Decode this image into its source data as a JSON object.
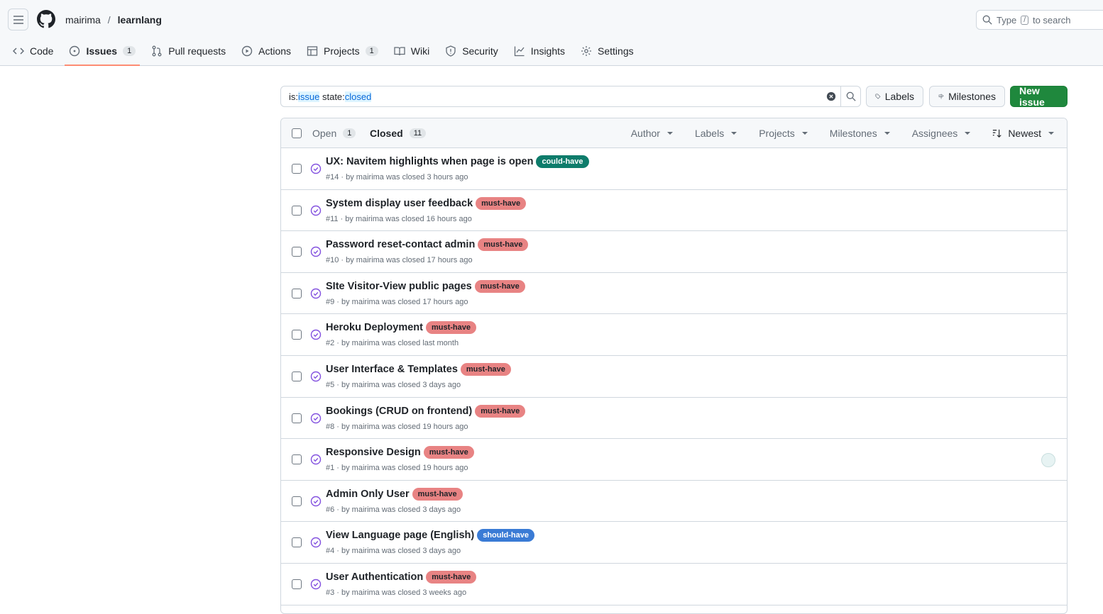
{
  "header": {
    "owner": "mairima",
    "separator": "/",
    "repo": "learnlang",
    "search_prefix": "Type",
    "search_key": "/",
    "search_suffix": "to search"
  },
  "tabs": [
    {
      "label": "Code",
      "icon": "code-icon"
    },
    {
      "label": "Issues",
      "icon": "issue-opened-icon",
      "count": "1",
      "active": true
    },
    {
      "label": "Pull requests",
      "icon": "git-pull-request-icon"
    },
    {
      "label": "Actions",
      "icon": "play-icon"
    },
    {
      "label": "Projects",
      "icon": "table-icon",
      "count": "1"
    },
    {
      "label": "Wiki",
      "icon": "book-icon"
    },
    {
      "label": "Security",
      "icon": "shield-icon"
    },
    {
      "label": "Insights",
      "icon": "graph-icon"
    },
    {
      "label": "Settings",
      "icon": "gear-icon"
    }
  ],
  "filter": {
    "prefix1": "is:",
    "value1": "issue",
    "prefix2": " state:",
    "value2": "closed"
  },
  "buttons": {
    "labels": "Labels",
    "milestones": "Milestones",
    "new_issue": "New issue"
  },
  "list_header": {
    "open_label": "Open",
    "open_count": "1",
    "closed_label": "Closed",
    "closed_count": "11",
    "filters": [
      "Author",
      "Labels",
      "Projects",
      "Milestones",
      "Assignees"
    ],
    "sort": "Newest"
  },
  "label_colors": {
    "could-have": {
      "bg": "#0e7c6b",
      "fg": "#ffffff"
    },
    "must-have": {
      "bg": "#e88383",
      "fg": "#1f2328"
    },
    "should-have": {
      "bg": "#3a7bd5",
      "fg": "#ffffff"
    }
  },
  "issues": [
    {
      "title": "UX: Navitem highlights when page is open",
      "label": "could-have",
      "meta": "#14 · by mairima was closed 3 hours ago"
    },
    {
      "title": "System display user feedback",
      "label": "must-have",
      "meta": "#11 · by mairima was closed 16 hours ago"
    },
    {
      "title": "Password reset-contact admin",
      "label": "must-have",
      "meta": "#10 · by mairima was closed 17 hours ago"
    },
    {
      "title": "SIte Visitor-View public pages",
      "label": "must-have",
      "meta": "#9 · by mairima was closed 17 hours ago"
    },
    {
      "title": "Heroku Deployment",
      "label": "must-have",
      "meta": "#2 · by mairima was closed last month"
    },
    {
      "title": "User Interface & Templates",
      "label": "must-have",
      "meta": "#5 · by mairima was closed 3 days ago"
    },
    {
      "title": "Bookings (CRUD on frontend)",
      "label": "must-have",
      "meta": "#8 · by mairima was closed 19 hours ago"
    },
    {
      "title": "Responsive Design",
      "label": "must-have",
      "meta": "#1 · by mairima was closed 19 hours ago",
      "assignee_avatar": true
    },
    {
      "title": "Admin Only User",
      "label": "must-have",
      "meta": "#6 · by mairima was closed 3 days ago"
    },
    {
      "title": "View Language page (English)",
      "label": "should-have",
      "meta": "#4 · by mairima was closed 3 days ago"
    },
    {
      "title": "User Authentication",
      "label": "must-have",
      "meta": "#3 · by mairima was closed 3 weeks ago"
    }
  ]
}
